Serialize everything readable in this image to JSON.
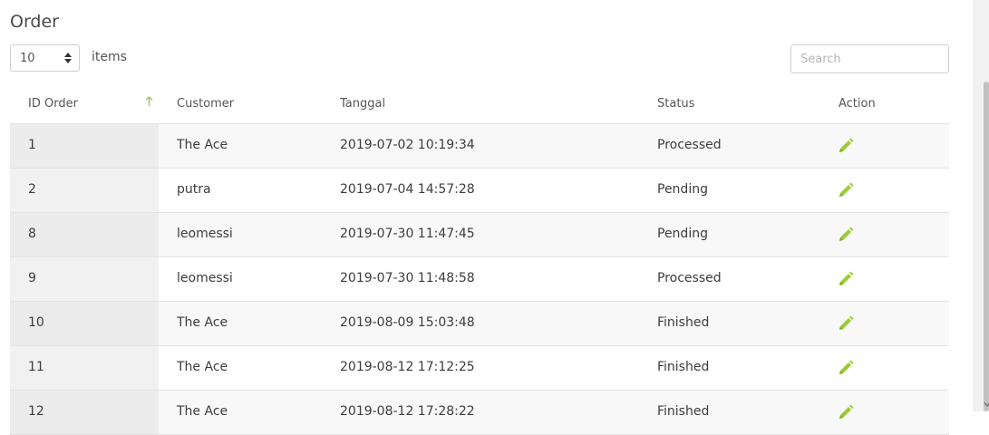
{
  "page": {
    "title": "Order"
  },
  "controls": {
    "length_value": "10",
    "items_label": "items",
    "search_placeholder": "Search"
  },
  "table": {
    "columns": [
      "ID Order",
      "Customer",
      "Tanggal",
      "Status",
      "Action"
    ],
    "sorted_column": "ID Order",
    "sort_direction": "ascending",
    "rows": [
      {
        "id": "1",
        "customer": "The Ace",
        "date": "2019-07-02 10:19:34",
        "status": "Processed"
      },
      {
        "id": "2",
        "customer": "putra",
        "date": "2019-07-04 14:57:28",
        "status": "Pending"
      },
      {
        "id": "8",
        "customer": "leomessi",
        "date": "2019-07-30 11:47:45",
        "status": "Pending"
      },
      {
        "id": "9",
        "customer": "leomessi",
        "date": "2019-07-30 11:48:58",
        "status": "Processed"
      },
      {
        "id": "10",
        "customer": "The Ace",
        "date": "2019-08-09 15:03:48",
        "status": "Finished"
      },
      {
        "id": "11",
        "customer": "The Ace",
        "date": "2019-08-12 17:12:25",
        "status": "Finished"
      },
      {
        "id": "12",
        "customer": "The Ace",
        "date": "2019-08-12 17:28:22",
        "status": "Finished"
      }
    ],
    "action_icon": "pencil-icon"
  },
  "colors": {
    "accent": "#9acd32",
    "sort_arrow": "#8bc34a"
  }
}
